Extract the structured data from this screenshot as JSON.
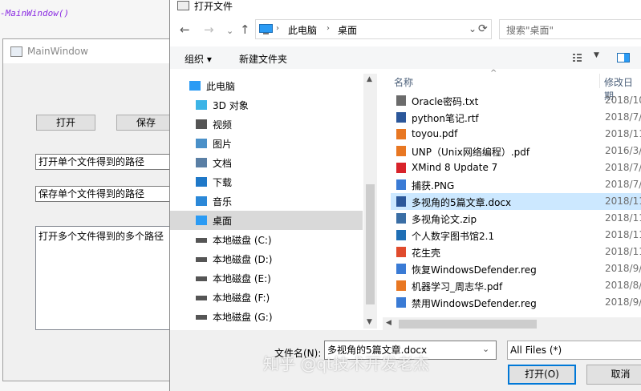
{
  "editor": {
    "code": "-MainWindow()"
  },
  "main_window": {
    "title": "MainWindow",
    "open_button": "打开",
    "save_button": "保存",
    "open_single_path": "打开单个文件得到的路径",
    "save_single_path": "保存单个文件得到的路径",
    "open_multi_paths": "打开多个文件得到的多个路径"
  },
  "dialog": {
    "title": "打开文件",
    "breadcrumb": [
      "此电脑",
      "桌面"
    ],
    "search_placeholder": "搜索\"桌面\"",
    "toolbar": {
      "organize": "组织 ▾",
      "new_folder": "新建文件夹"
    },
    "tree": [
      {
        "label": "此电脑",
        "icon": "computer-icon"
      },
      {
        "label": "3D 对象",
        "icon": "3d-objects-icon"
      },
      {
        "label": "视频",
        "icon": "video-icon"
      },
      {
        "label": "图片",
        "icon": "picture-icon"
      },
      {
        "label": "文档",
        "icon": "document-icon"
      },
      {
        "label": "下载",
        "icon": "download-icon"
      },
      {
        "label": "音乐",
        "icon": "music-icon"
      },
      {
        "label": "桌面",
        "icon": "desktop-icon",
        "selected": true
      },
      {
        "label": "本地磁盘 (C:)",
        "icon": "drive-icon"
      },
      {
        "label": "本地磁盘 (D:)",
        "icon": "drive-icon"
      },
      {
        "label": "本地磁盘 (E:)",
        "icon": "drive-icon"
      },
      {
        "label": "本地磁盘 (F:)",
        "icon": "drive-icon"
      },
      {
        "label": "本地磁盘 (G:)",
        "icon": "drive-icon"
      }
    ],
    "columns": {
      "name": "名称",
      "date": "修改日期"
    },
    "files": [
      {
        "name": "Oracle密码.txt",
        "date": "2018/10",
        "icon": "txt-icon",
        "color": "#6b6b6b"
      },
      {
        "name": "python笔记.rtf",
        "date": "2018/7/2",
        "icon": "rtf-icon",
        "color": "#2b579a"
      },
      {
        "name": "toyou.pdf",
        "date": "2018/11",
        "icon": "pdf-icon",
        "color": "#e87722"
      },
      {
        "name": "UNP（Unix网络编程）.pdf",
        "date": "2016/3/",
        "icon": "pdf-icon",
        "color": "#e87722"
      },
      {
        "name": "XMind 8 Update 7",
        "date": "2018/7/",
        "icon": "xmind-icon",
        "color": "#d8232a"
      },
      {
        "name": "捕获.PNG",
        "date": "2018/7/2",
        "icon": "png-icon",
        "color": "#3a7bd5"
      },
      {
        "name": "多视角的5篇文章.docx",
        "date": "2018/11",
        "icon": "docx-icon",
        "color": "#2b579a",
        "selected": true
      },
      {
        "name": "多视角论文.zip",
        "date": "2018/11",
        "icon": "zip-icon",
        "color": "#3a6ea5"
      },
      {
        "name": "个人数字图书馆2.1",
        "date": "2018/11",
        "icon": "app-icon",
        "color": "#1f6fb5"
      },
      {
        "name": "花生壳",
        "date": "2018/11",
        "icon": "peanut-icon",
        "color": "#e04b2d"
      },
      {
        "name": "恢复WindowsDefender.reg",
        "date": "2018/9/",
        "icon": "reg-icon",
        "color": "#3a7bd5"
      },
      {
        "name": "机器学习_周志华.pdf",
        "date": "2018/8/",
        "icon": "pdf-icon",
        "color": "#e87722"
      },
      {
        "name": "禁用WindowsDefender.reg",
        "date": "2018/9/",
        "icon": "reg-icon",
        "color": "#3a7bd5"
      }
    ],
    "filename_label": "文件名(N):",
    "filename_value": "多视角的5篇文章.docx",
    "filter_value": "All Files (*)",
    "open_button": "打开(O)",
    "cancel_button": "取消"
  },
  "watermark": "知乎 @qt技术开发老杰"
}
